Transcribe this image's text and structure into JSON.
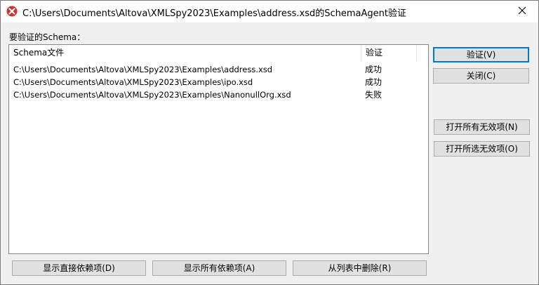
{
  "titlebar": {
    "title": "C:\\Users\\Documents\\Altova\\XMLSpy2023\\Examples\\address.xsd的SchemaAgent验证",
    "icon": "xmlspy-app-icon",
    "close_icon": "close-icon"
  },
  "list": {
    "label": "要验证的Schema：",
    "columns": {
      "file": "Schema文件",
      "status": "验证"
    },
    "rows": [
      {
        "file": "C:\\Users\\Documents\\Altova\\XMLSpy2023\\Examples\\address.xsd",
        "status": "成功"
      },
      {
        "file": "C:\\Users\\Documents\\Altova\\XMLSpy2023\\Examples\\ipo.xsd",
        "status": "成功"
      },
      {
        "file": "C:\\Users\\Documents\\Altova\\XMLSpy2023\\Examples\\NanonullOrg.xsd",
        "status": "失败"
      }
    ]
  },
  "buttons": {
    "validate": "验证(V)",
    "close": "关闭(C)",
    "open_all_invalid": "打开所有无效项(N)",
    "open_selected_invalid": "打开所选无效项(O)",
    "show_direct_deps": "显示直接依赖项(D)",
    "show_all_deps": "显示所有依赖项(A)",
    "remove_from_list": "从列表中删除(R)"
  }
}
